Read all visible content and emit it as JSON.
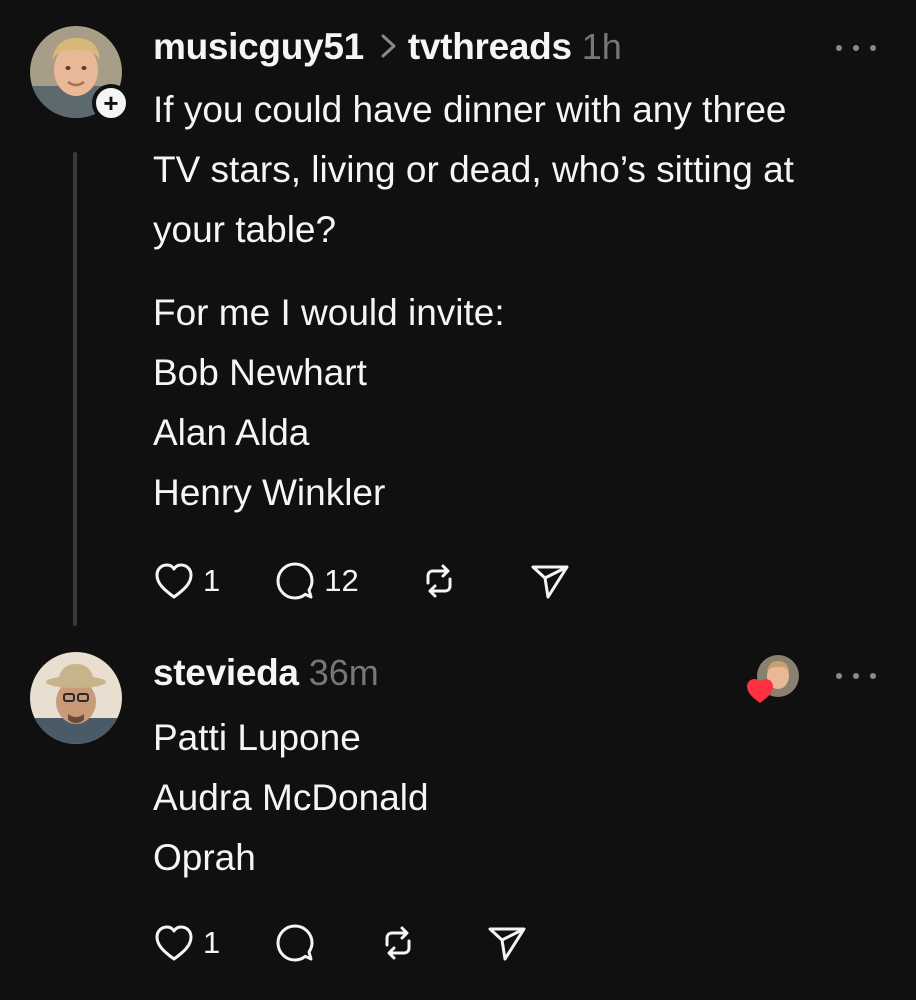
{
  "posts": [
    {
      "username": "musicguy51",
      "community": "tvthreads",
      "time": "1h",
      "body_lines": [
        "If you could have dinner with any three",
        "TV stars, living or dead, who’s sitting at",
        "your table?"
      ],
      "body_lines_2": [
        "For me I would invite:",
        "Bob Newhart",
        "Alan Alda",
        "Henry Winkler"
      ],
      "actions": {
        "like_count": "1",
        "reply_count": "12"
      }
    },
    {
      "username": "stevieda",
      "time": "36m",
      "body_lines": [
        "Patti Lupone",
        "Audra McDonald",
        "Oprah"
      ],
      "actions": {
        "like_count": "1"
      }
    }
  ],
  "icons": {
    "follow": "plus-icon",
    "more": "more-icon",
    "like": "heart-icon",
    "reply": "comment-icon",
    "repost": "repost-icon",
    "share": "send-icon",
    "liked_badge": "heart-filled-icon"
  },
  "colors": {
    "background": "#101010",
    "text": "#f3f5f7",
    "muted": "#777777",
    "heart": "#ff3040"
  }
}
